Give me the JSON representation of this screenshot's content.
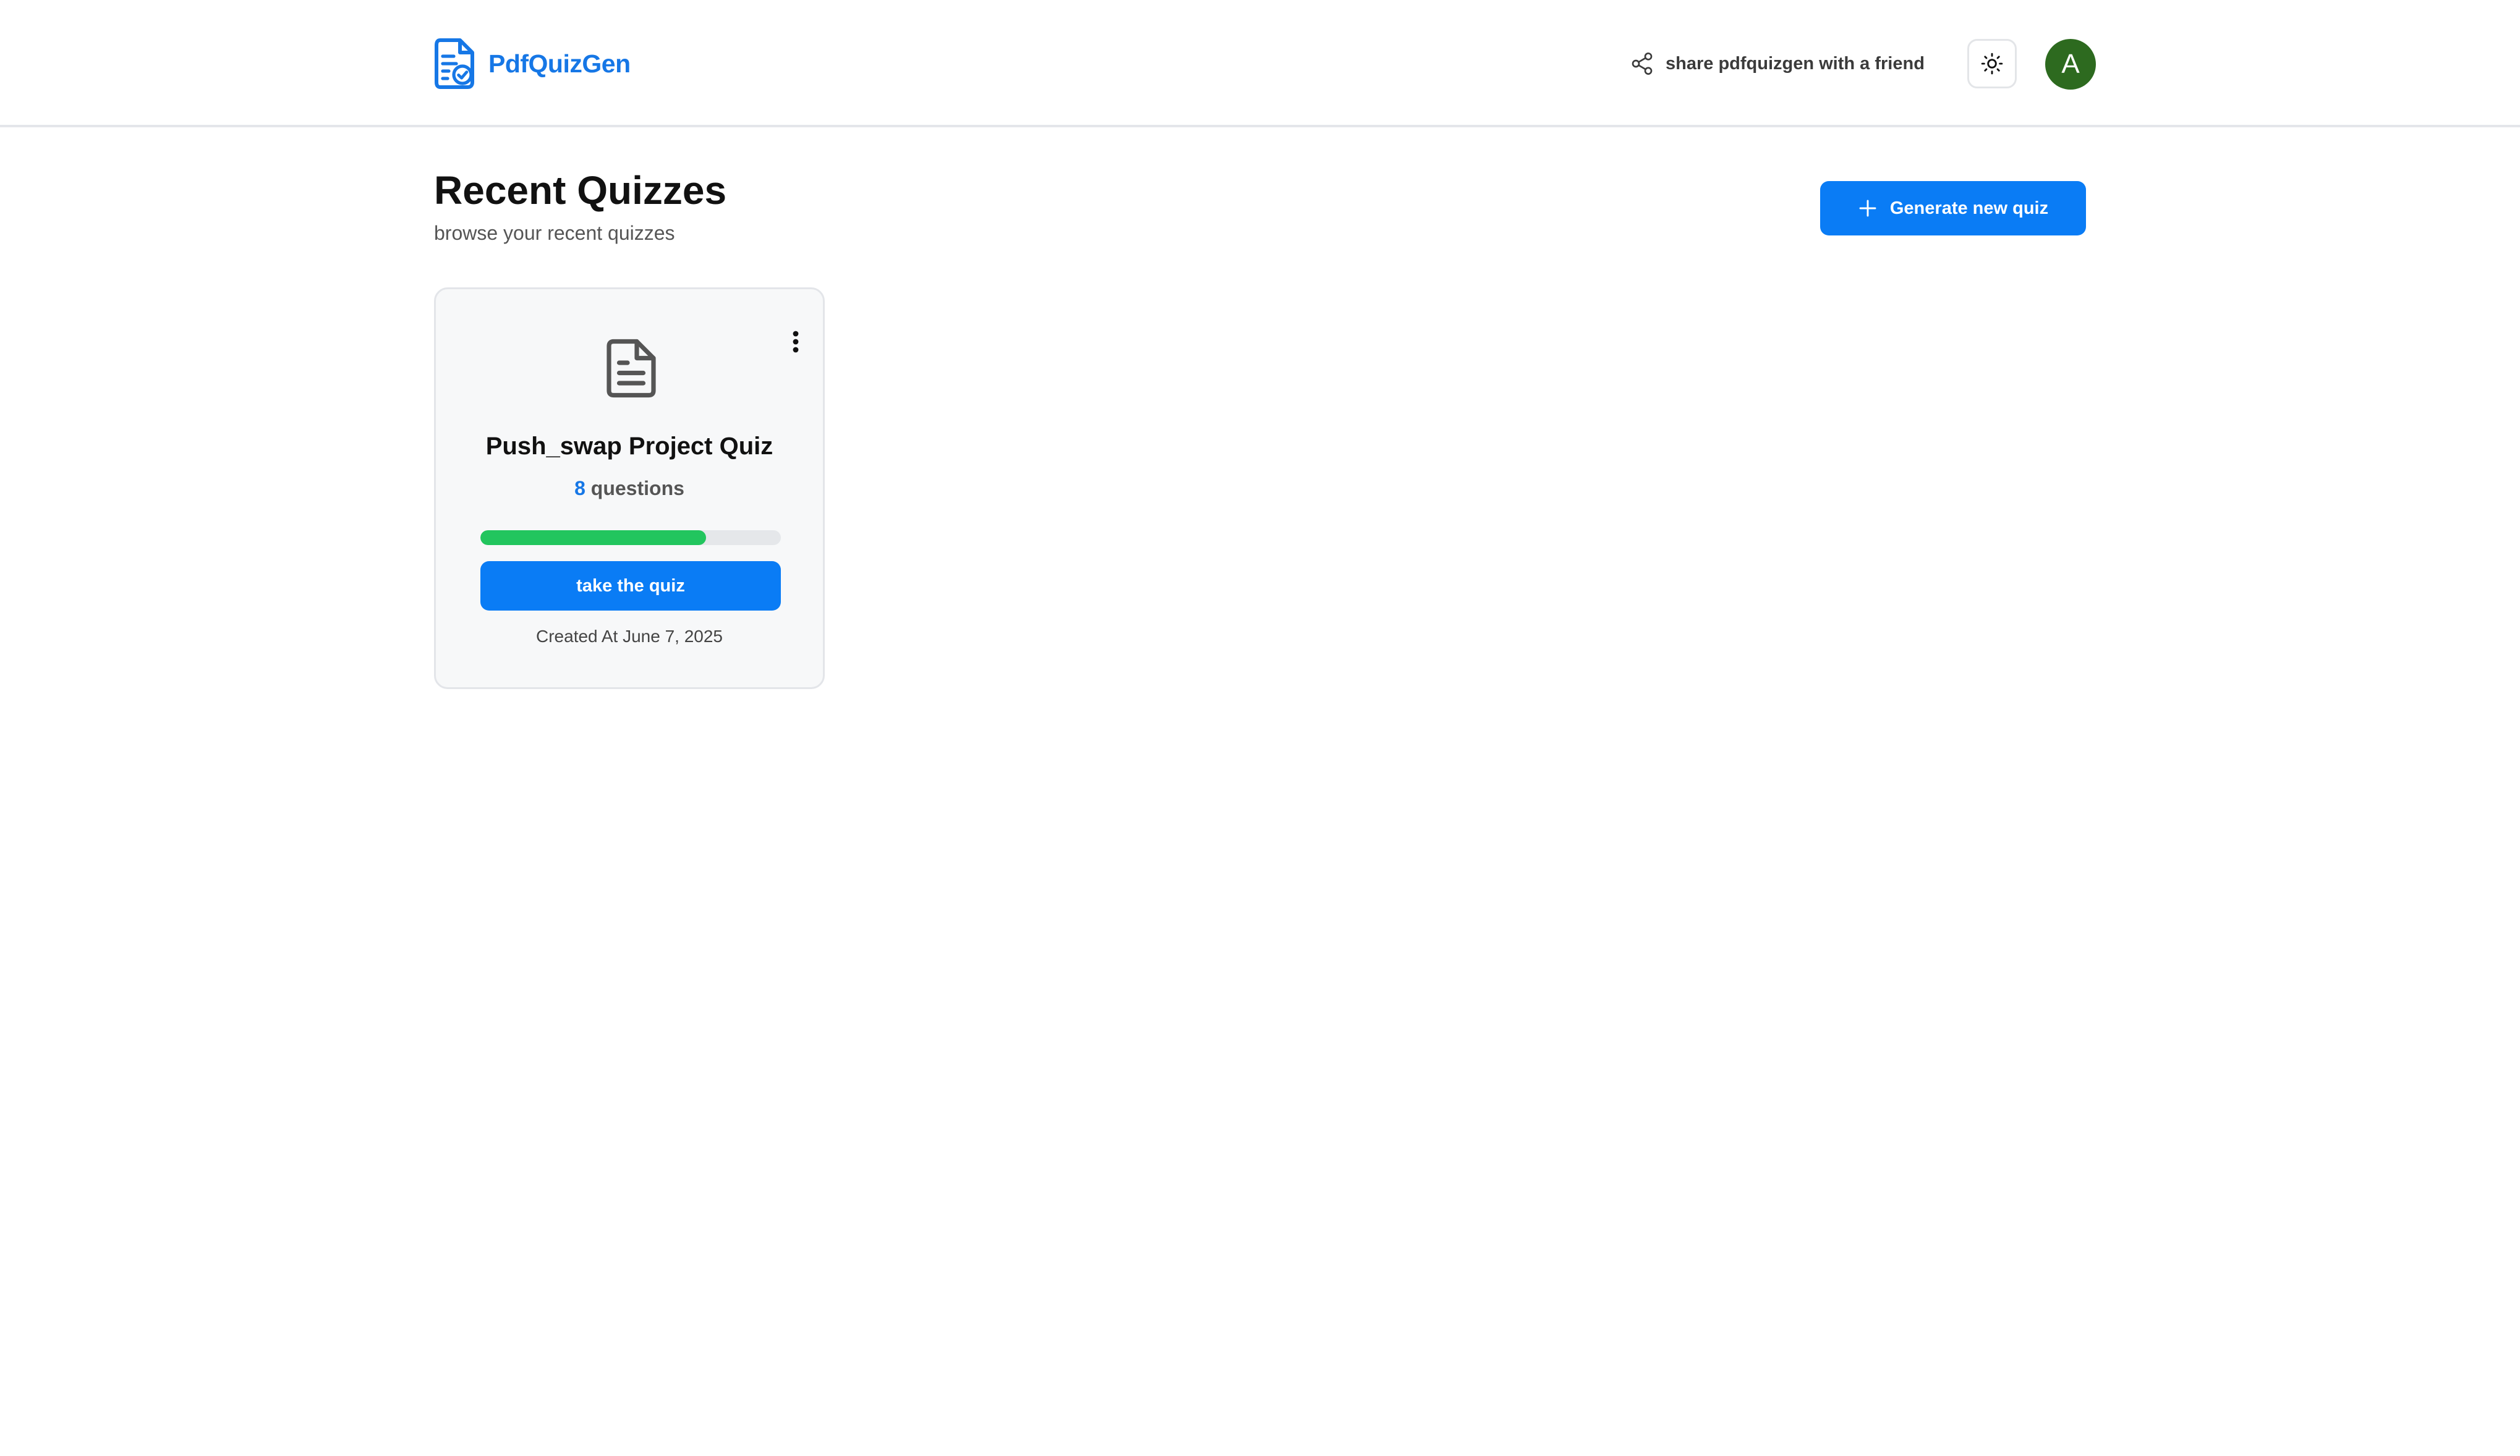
{
  "header": {
    "brand": "PdfQuizGen",
    "share_text": "share pdfquizgen with a friend",
    "avatar_initial": "A"
  },
  "main": {
    "title": "Recent Quizzes",
    "subtitle": "browse your recent quizzes",
    "generate_label": "Generate new quiz"
  },
  "quizzes": [
    {
      "title": "Push_swap Project Quiz",
      "question_count": "8",
      "question_suffix": " questions",
      "progress_fraction": 0.75,
      "action_label": "take the quiz",
      "created": "Created At June 7, 2025"
    }
  ],
  "colors": {
    "brand": "#1677e6",
    "primary_button": "#0a7cf5",
    "progress": "#22c55e",
    "avatar": "#2d6a1f"
  },
  "icons": {
    "logo": "quiz-document-check-icon",
    "share": "share-icon",
    "theme": "sun-icon",
    "generate": "plus-icon",
    "card_menu": "kebab-menu-icon",
    "card_doc": "document-icon"
  }
}
